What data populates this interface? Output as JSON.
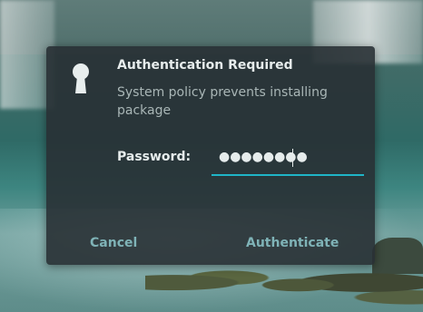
{
  "dialog": {
    "title": "Authentication Required",
    "message": "System policy prevents installing package",
    "password_label": "Password:",
    "password_value": "●●●●●●●●",
    "cancel_label": "Cancel",
    "authenticate_label": "Authenticate",
    "icon": "lock-icon"
  },
  "colors": {
    "accent": "#1fb5c7",
    "button_text": "#7fb3b7",
    "dialog_bg": "#283034",
    "title_text": "#e6ecec",
    "message_text": "#a9b6b6"
  }
}
